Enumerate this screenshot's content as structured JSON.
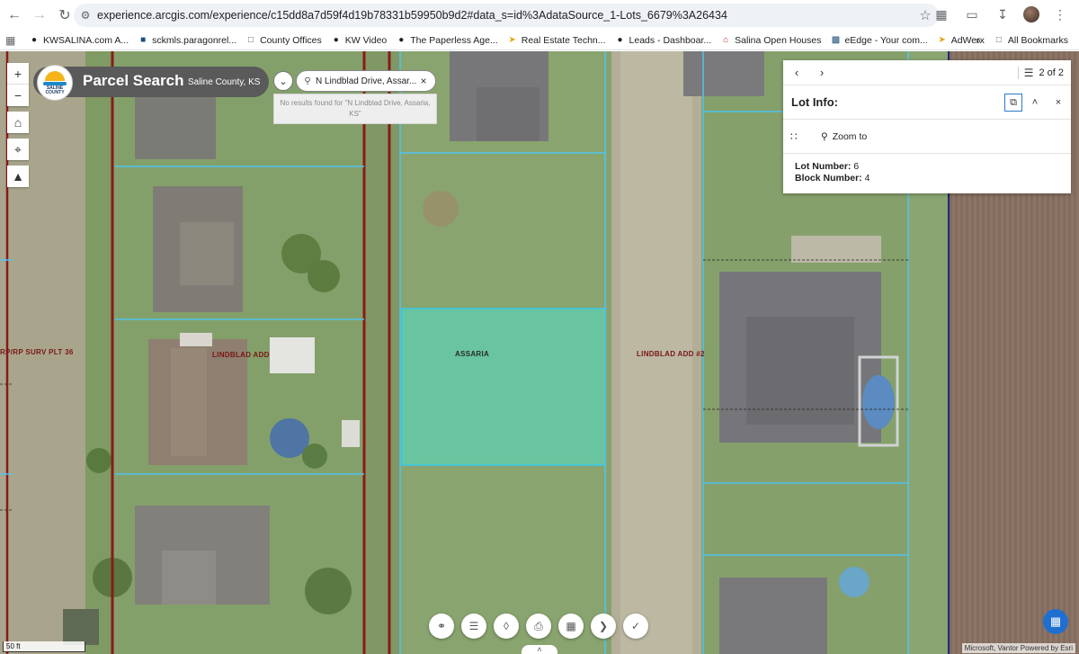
{
  "browser": {
    "url": "experience.arcgis.com/experience/c15dd8a7d59f4d19b78331b59950b9d2#data_s=id%3AdataSource_1-Lots_6679%3A26434",
    "bookmarks": [
      {
        "label": "KWSALINA.com A...",
        "icon": "kw-icon"
      },
      {
        "label": "sckmls.paragonrel...",
        "icon": "mls-icon"
      },
      {
        "label": "County Offices",
        "icon": "folder-icon"
      },
      {
        "label": "KW Video",
        "icon": "kw-icon"
      },
      {
        "label": "The Paperless Age...",
        "icon": "kw-icon"
      },
      {
        "label": "Real Estate Techn...",
        "icon": "bolt-icon"
      },
      {
        "label": "Leads - Dashboar...",
        "icon": "kw-icon"
      },
      {
        "label": "Salina Open Houses",
        "icon": "house-icon"
      },
      {
        "label": "eEdge - Your com...",
        "icon": "chart-icon"
      },
      {
        "label": "AdWerx",
        "icon": "bolt-icon"
      }
    ],
    "all_bookmarks": "All Bookmarks"
  },
  "header": {
    "logo_text": "SALINE COUNTY",
    "title": "Parcel Search",
    "subtitle": "Saline County, KS"
  },
  "search": {
    "value": "N Lindblad Drive, Assar...",
    "no_results": "No results found for \"N Lindblad Drive, Assaria, KS\""
  },
  "map": {
    "labels": {
      "surv": "RP/RP SURV PLT 36",
      "lindblad": "LINDBLAD ADD",
      "assaria": "ASSARIA",
      "lindblad2": "LINDBLAD ADD #2"
    },
    "scale": "50 ft",
    "attribution": "Microsoft, Vantor   Powered by Esri"
  },
  "info_panel": {
    "count": "2 of 2",
    "title": "Lot Info:",
    "zoom_to": "Zoom to",
    "lot_label": "Lot Number:",
    "lot_value": "6",
    "block_label": "Block Number:",
    "block_value": "4"
  },
  "colors": {
    "parcel_outline": "#4fc3ef",
    "selected_fill": "#4fe0c8",
    "road_line": "#8b1a1a",
    "header_bg": "#5a5a5a",
    "accent": "#1f6fd1"
  }
}
